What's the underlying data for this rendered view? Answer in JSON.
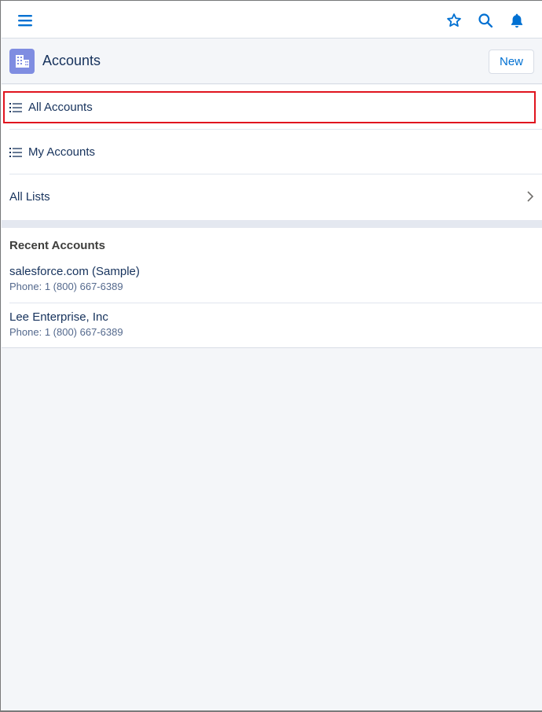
{
  "topbar": {
    "icons": [
      "menu-icon",
      "star-icon",
      "search-icon",
      "bell-icon"
    ]
  },
  "header": {
    "title": "Accounts",
    "object_icon": "accounts-building-icon",
    "new_label": "New"
  },
  "lists": [
    {
      "label": "All Accounts",
      "icon": "list-icon",
      "highlighted": true
    },
    {
      "label": "My Accounts",
      "icon": "list-icon"
    },
    {
      "label": "All Lists",
      "icon": "chevron-right-icon"
    }
  ],
  "recent": {
    "title": "Recent Accounts",
    "items": [
      {
        "name": "salesforce.com (Sample)",
        "phone": "Phone: 1 (800) 667-6389"
      },
      {
        "name": "Lee Enterprise, Inc",
        "phone": "Phone: 1 (800) 667-6389"
      }
    ]
  },
  "colors": {
    "accent": "#0070d2",
    "object_icon_bg": "#7f8de1",
    "highlight_border": "#e0141e"
  }
}
